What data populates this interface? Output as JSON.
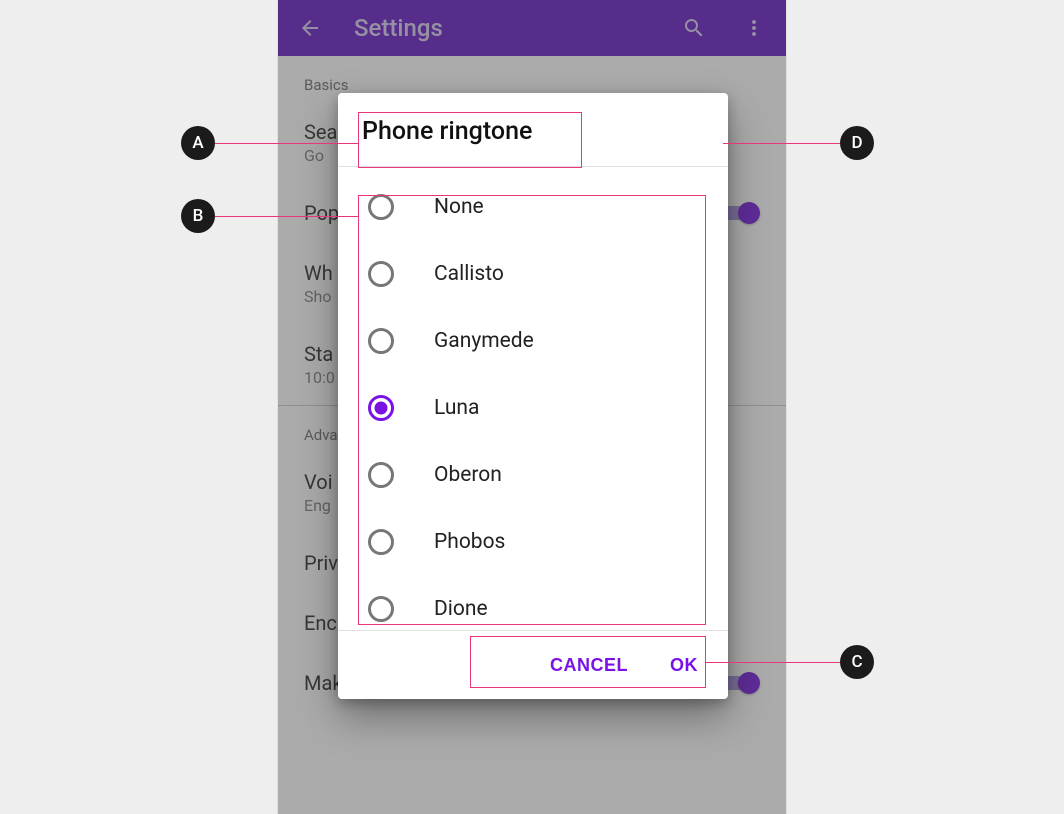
{
  "appbar": {
    "title": "Settings"
  },
  "bg": {
    "section_basics": "Basics",
    "section_adv": "Adva",
    "rows": [
      {
        "primary": "Sea",
        "secondary": "Go"
      },
      {
        "primary": "Pop"
      },
      {
        "primary": "Wh",
        "secondary": "Sho"
      },
      {
        "primary": "Sta",
        "secondary": "10:0"
      },
      {
        "primary": "Voi",
        "secondary": "Eng"
      },
      {
        "primary": "Priv"
      },
      {
        "primary": "Encryption"
      },
      {
        "primary": "Make passwords visible"
      }
    ]
  },
  "dialog": {
    "title": "Phone ringtone",
    "options": [
      {
        "label": "None",
        "selected": false
      },
      {
        "label": "Callisto",
        "selected": false
      },
      {
        "label": "Ganymede",
        "selected": false
      },
      {
        "label": "Luna",
        "selected": true
      },
      {
        "label": "Oberon",
        "selected": false
      },
      {
        "label": "Phobos",
        "selected": false
      },
      {
        "label": "Dione",
        "selected": false
      }
    ],
    "cancel": "CANCEL",
    "ok": "OK"
  },
  "annotations": {
    "a": "A",
    "b": "B",
    "c": "C",
    "d": "D"
  }
}
